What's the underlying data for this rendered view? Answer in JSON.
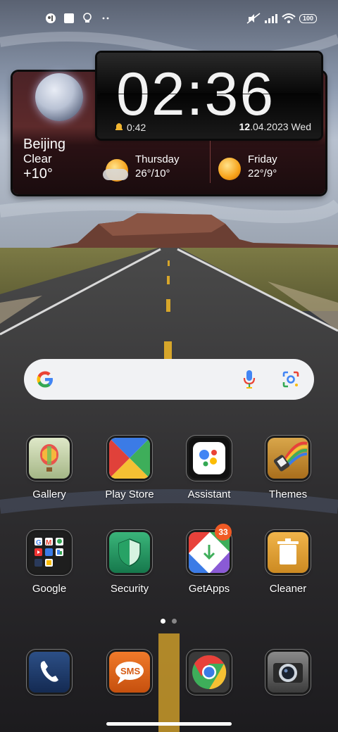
{
  "status_bar": {
    "left_icons": [
      "notification-app-icon",
      "white-square-icon",
      "lightbulb-icon",
      "more-dots-icon"
    ],
    "right_icons": [
      "mute-icon",
      "signal-icon",
      "wifi-icon"
    ],
    "battery": "100"
  },
  "clock_widget": {
    "time": "02:36",
    "alarm": "0:42",
    "date_day": "12",
    "date_rest": ".04.2023 Wed"
  },
  "weather": {
    "city": "Beijing",
    "condition": "Clear",
    "temperature": "+10°",
    "forecast": [
      {
        "day": "Thursday",
        "temp": "26°/10°",
        "icon": "partly-cloudy-icon"
      },
      {
        "day": "Friday",
        "temp": "22°/9°",
        "icon": "sun-icon"
      }
    ]
  },
  "search": {
    "icons": [
      "google-g-icon",
      "microphone-icon",
      "google-lens-icon"
    ]
  },
  "apps_row1": [
    {
      "label": "Gallery",
      "icon": "gallery-icon"
    },
    {
      "label": "Play Store",
      "icon": "play-store-icon"
    },
    {
      "label": "Assistant",
      "icon": "assistant-icon"
    },
    {
      "label": "Themes",
      "icon": "themes-icon"
    }
  ],
  "apps_row2": [
    {
      "label": "Google",
      "icon": "google-folder-icon"
    },
    {
      "label": "Security",
      "icon": "security-icon"
    },
    {
      "label": "GetApps",
      "icon": "getapps-icon",
      "badge": "33"
    },
    {
      "label": "Cleaner",
      "icon": "cleaner-icon"
    }
  ],
  "dock": [
    {
      "icon": "phone-icon"
    },
    {
      "icon": "sms-icon",
      "text": "SMS"
    },
    {
      "icon": "chrome-icon"
    },
    {
      "icon": "camera-icon"
    }
  ],
  "page_indicator": {
    "pages": 2,
    "current": 1
  }
}
